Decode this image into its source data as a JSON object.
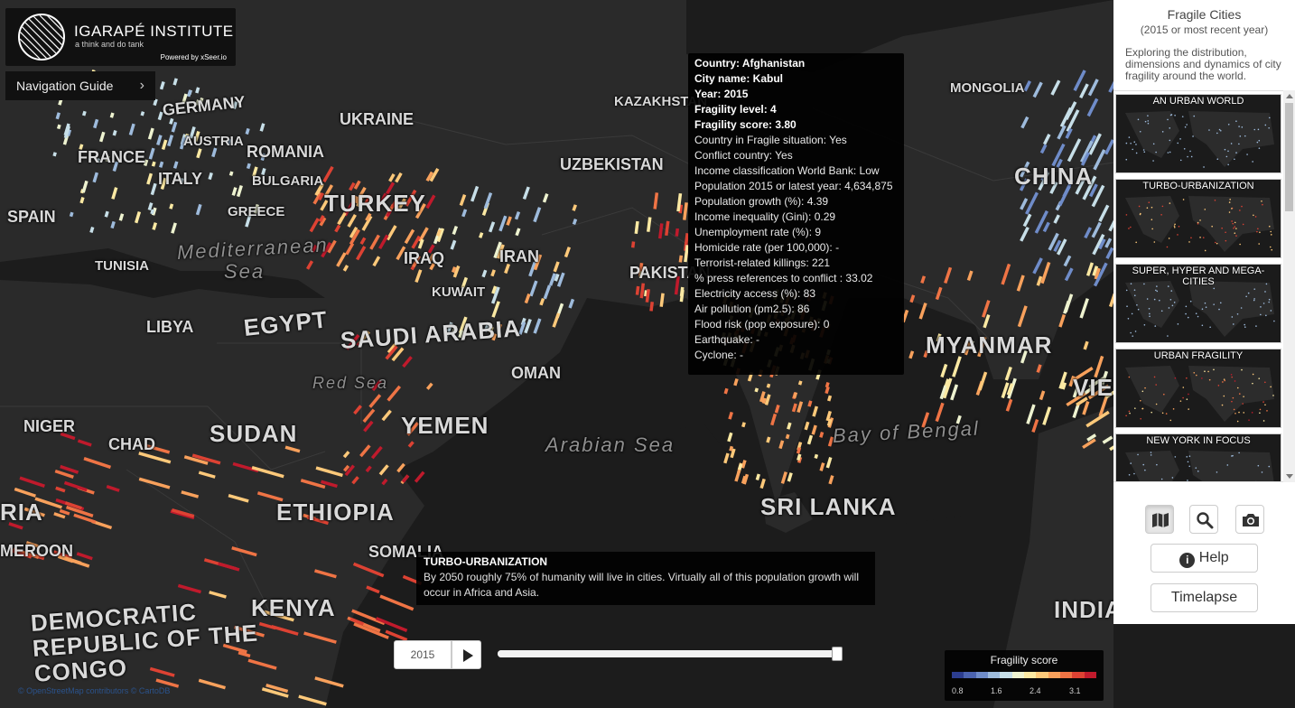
{
  "logo": {
    "title": "IGARAPÉ INSTITUTE",
    "tagline": "a think and do tank",
    "powered": "Powered by xSeer.io"
  },
  "nav_guide": {
    "label": "Navigation Guide",
    "icon": "chevron-right-icon"
  },
  "map_labels": {
    "countries": [
      "GERMANY",
      "UKRAINE",
      "FRANCE",
      "AUSTRIA",
      "ROMANIA",
      "BULGARIA",
      "ITALY",
      "GREECE",
      "SPAIN",
      "TURKEY",
      "TUNISIA",
      "LIBYA",
      "EGYPT",
      "SAUDI ARABIA",
      "OMAN",
      "YEMEN",
      "SUDAN",
      "CHAD",
      "NIGER",
      "ETHIOPIA",
      "SOMALIA",
      "KENYA",
      "DEMOCRATIC REPUBLIC OF THE CONGO",
      "KAZAKHSTAN",
      "UZBEKISTAN",
      "MONGOLIA",
      "CHINA",
      "MYANMAR",
      "SRI LANKA",
      "IRAQ",
      "KUWAIT",
      "IRAN",
      "PAKISTAN",
      "INDIA",
      "RIA",
      "MEROON",
      "VIE"
    ],
    "seas": [
      "Mediterranean",
      "Sea",
      "Red Sea",
      "Arabian Sea",
      "Bay of Bengal"
    ]
  },
  "tooltip": {
    "country": "Country: Afghanistan",
    "city": "City name: Kabul",
    "year": "Year: 2015",
    "level": "Fragility level: 4",
    "score": "Fragility score: 3.80",
    "rows": [
      "Country in Fragile situation: Yes",
      "Conflict country: Yes",
      "Income classification World Bank: Low",
      "Population 2015 or latest year: 4,634,875",
      "Population growth (%): 4.39",
      "Income inequality (Gini): 0.29",
      "Unemployment rate (%): 9",
      "Homicide rate (per 100,000): -",
      "Terrorist-related killings: 221",
      "% press references to conflict : 33.02",
      "Electricity access (%): 83",
      "Air pollution (pm2.5): 86",
      "Flood risk (pop exposure): 0",
      "Earthquake: -",
      "Cyclone: -"
    ]
  },
  "caption": {
    "title": "TURBO-URBANIZATION",
    "text": "By 2050 roughly 75% of humanity will live in cities. Virtually all of this population growth will occur in Africa and Asia."
  },
  "timeline": {
    "year": "2015",
    "progress": 0.99,
    "play_icon": "play-icon"
  },
  "legend": {
    "title": "Fragility score",
    "ticks": [
      "0.8",
      "1.6",
      "2.4",
      "3.1"
    ],
    "colors": [
      "#2c3d8f",
      "#4b63b0",
      "#6f8cc9",
      "#9ebbdc",
      "#c7dfe8",
      "#eef3d0",
      "#fbe9a3",
      "#fdc97a",
      "#f8a15c",
      "#ef7445",
      "#dd4233",
      "#c01a2c"
    ]
  },
  "attribution": "© OpenStreetMap contributors © CartoDB",
  "panel": {
    "title": "Fragile Cities",
    "subtitle": "(2015 or most recent year)",
    "description": "Exploring the distribution, dimensions and dynamics of city fragility around the world.",
    "cards": [
      {
        "label": "AN URBAN WORLD"
      },
      {
        "label": "TURBO-URBANIZATION"
      },
      {
        "label": "SUPER, HYPER AND MEGA-CITIES"
      },
      {
        "label": "URBAN FRAGILITY"
      },
      {
        "label": "NEW YORK IN FOCUS"
      }
    ],
    "icon_buttons": [
      "map-icon",
      "search-icon",
      "camera-icon"
    ],
    "help_label": "Help",
    "timelapse_label": "Timelapse"
  }
}
